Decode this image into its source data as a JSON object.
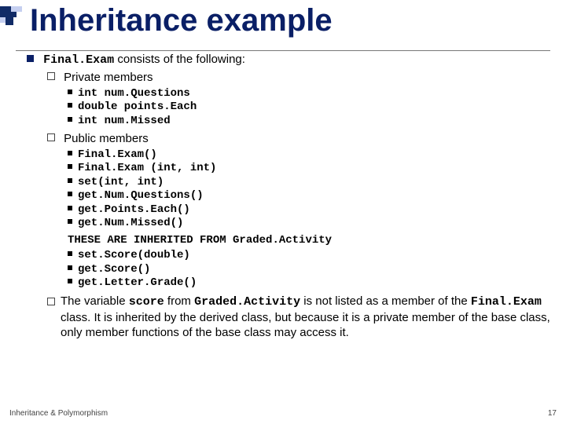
{
  "title": "Inheritance example",
  "lead_text_prefix": "Final.Exam",
  "lead_text_rest": " consists of the following:",
  "sections": {
    "private": {
      "label": "Private members",
      "items": [
        "int num.Questions",
        "double points.Each",
        "int num.Missed"
      ]
    },
    "public": {
      "label": "Public members",
      "items_before": [
        "Final.Exam()",
        "Final.Exam (int, int)",
        "set(int, int)",
        "get.Num.Questions()",
        "get.Points.Each()",
        "get.Num.Missed()"
      ],
      "inherit_note": "THESE ARE INHERITED FROM Graded.Activity",
      "items_after": [
        "set.Score(double)",
        "get.Score()",
        "get.Letter.Grade()"
      ]
    },
    "note": {
      "t1": "The variable ",
      "code1": "score",
      "t2": " from ",
      "code2": "Graded.Activity",
      "t3": " is not listed as a member of the ",
      "code3": "Final.Exam",
      "t4": " class. It is inherited by the derived class, but because it is a private member of the base class, only member functions of the base class may access it."
    }
  },
  "footer_left": "Inheritance & Polymorphism",
  "footer_right": "17"
}
